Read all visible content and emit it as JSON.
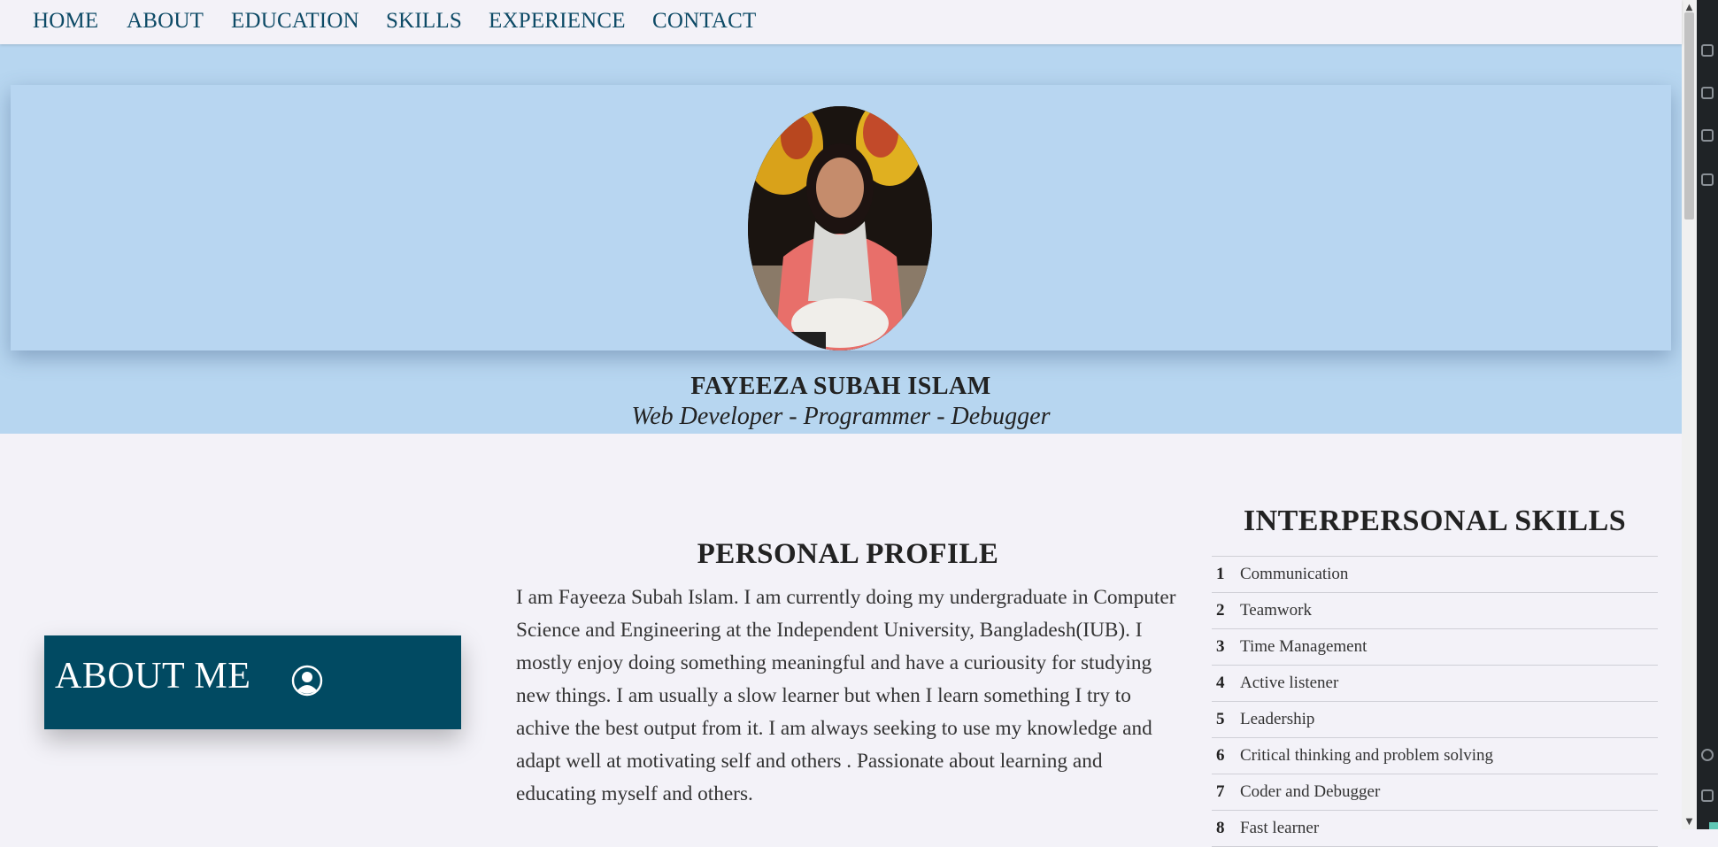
{
  "nav": {
    "items": [
      {
        "label": "HOME"
      },
      {
        "label": "ABOUT"
      },
      {
        "label": "EDUCATION"
      },
      {
        "label": "SKILLS"
      },
      {
        "label": "EXPERIENCE"
      },
      {
        "label": "CONTACT"
      }
    ]
  },
  "hero": {
    "name": "FAYEEZA SUBAH ISLAM",
    "role": "Web Developer - Programmer - Debugger"
  },
  "about": {
    "title": "ABOUT ME",
    "icon": "user-circle-icon"
  },
  "profile": {
    "title": "PERSONAL PROFILE",
    "text": "I am Fayeeza Subah Islam. I am currently doing my undergraduate in Computer Science and Engineering at the Independent University, Bangladesh(IUB). I mostly enjoy doing something meaningful and have a curiousity for studying new things. I am usually a slow learner but when I learn something I try to achive the best output from it. I am always seeking to use my knowledge and adapt well at motivating self and others . Passionate about learning and educating myself and others."
  },
  "skills": {
    "title": "INTERPERSONAL SKILLS",
    "items": [
      {
        "num": "1",
        "label": "Communication"
      },
      {
        "num": "2",
        "label": "Teamwork"
      },
      {
        "num": "3",
        "label": "Time Management"
      },
      {
        "num": "4",
        "label": "Active listener"
      },
      {
        "num": "5",
        "label": "Leadership"
      },
      {
        "num": "6",
        "label": "Critical thinking and problem solving"
      },
      {
        "num": "7",
        "label": "Coder and Debugger"
      },
      {
        "num": "8",
        "label": "Fast learner"
      }
    ]
  },
  "colors": {
    "nav_link": "#0d4a66",
    "hero_bg": "#b7d6f0",
    "about_box": "#014a62",
    "page_bg": "#f3f2f8"
  }
}
